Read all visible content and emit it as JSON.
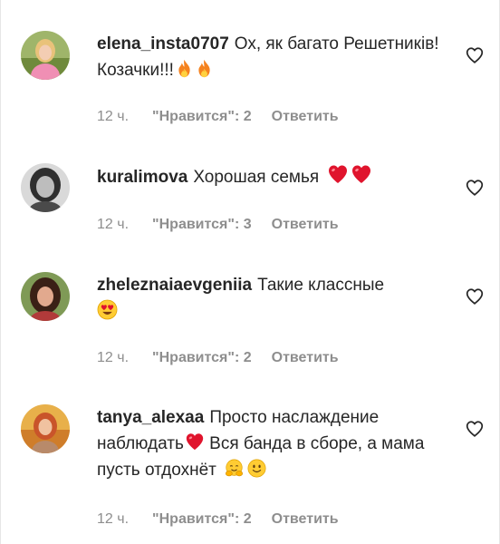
{
  "comments": [
    {
      "username": "elena_insta0707",
      "text": "Ох, як багато Решетників! Козачки!!!",
      "emojis": [
        "fire-emoji",
        "fire-emoji"
      ],
      "time": "12 ч.",
      "likes": "\"Нравится\": 2",
      "reply": "Ответить"
    },
    {
      "username": "kuralimova",
      "text": "Хорошая семья",
      "emojis": [
        "red-heart-emoji",
        "red-heart-emoji"
      ],
      "time": "12 ч.",
      "likes": "\"Нравится\": 3",
      "reply": "Ответить"
    },
    {
      "username": "zheleznaiaevgeniia",
      "text": "Такие классные",
      "emojis": [
        "heart-eyes-emoji"
      ],
      "time": "12 ч.",
      "likes": "\"Нравится\": 2",
      "reply": "Ответить"
    },
    {
      "username": "tanya_alexaa",
      "text_a": "Просто наслаждение наблюдать",
      "text_b": "Вся банда в сборе, а мама пусть отдохнёт",
      "emojis": [
        "red-heart-emoji",
        "hugging-emoji",
        "smiling-emoji"
      ],
      "time": "12 ч.",
      "likes": "\"Нравится\": 2",
      "reply": "Ответить"
    }
  ],
  "colors": {
    "text": "#262626",
    "meta": "#8e8e8e",
    "heart_red": "#e0142d",
    "fire_orange": "#f5821f",
    "emoji_yellow": "#ffcc33"
  },
  "icons": {
    "like": "heart-outline-icon"
  }
}
